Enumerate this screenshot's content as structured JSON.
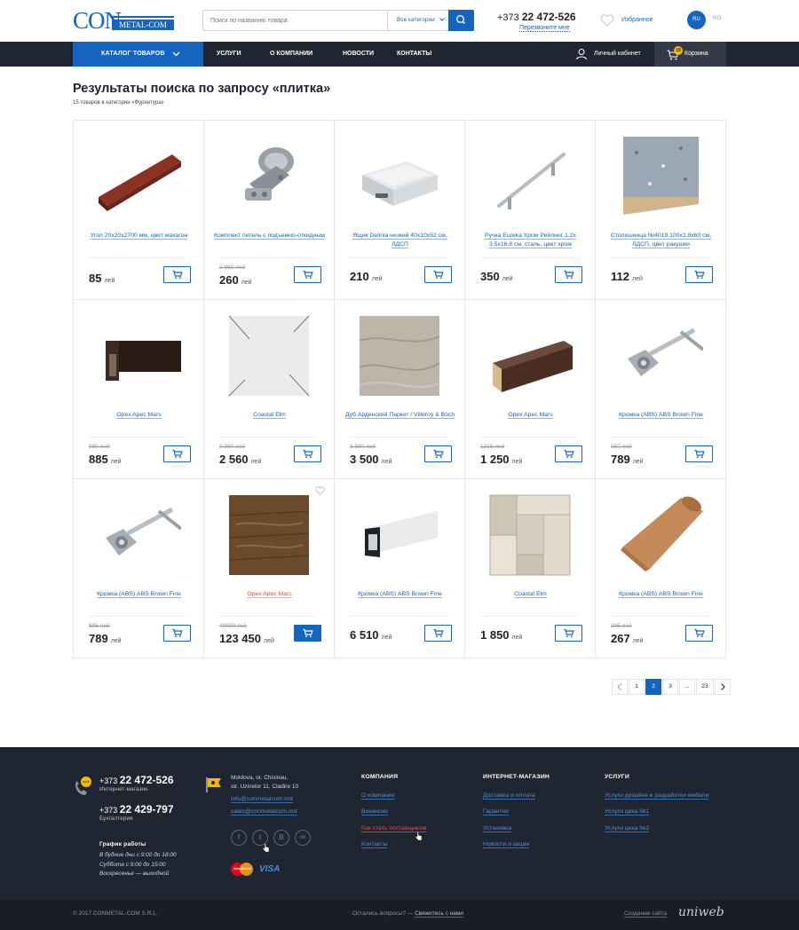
{
  "logo": {
    "text_top": "CON",
    "text_bottom": "METAL-COM"
  },
  "search": {
    "placeholder": "Поиск по названию товара",
    "category": "Все категории"
  },
  "contact": {
    "prefix": "+373",
    "phone": "22 472-526",
    "callback": "Перезвоните мне"
  },
  "favorites": "Избранное",
  "languages": [
    "RU",
    "RO"
  ],
  "nav": {
    "catalog": "КАТАЛОГ ТОВАРОВ",
    "items": [
      "УСЛУГИ",
      "О КОМПАНИИ",
      "НОВОСТИ",
      "КОНТАКТЫ"
    ],
    "cabinet": "Личный кабинет",
    "cart": "Корзина",
    "cart_count": "15"
  },
  "title": "Результаты поиска по запросу «плитка»",
  "subtitle": "15 товаров в категории «Фурнитура»",
  "currency": "лей",
  "products": [
    {
      "name": "Угол 20x20x2700 мм, цвет махагон",
      "old": "",
      "price": "85",
      "image": "angle-profile-image"
    },
    {
      "name": "Комплект петель с подъемно-откидным",
      "old": "2 980 лей",
      "price": "260",
      "image": "hinge-image"
    },
    {
      "name": "Ящик Delinia низкий 40x10x52 см, ЛДСП",
      "old": "",
      "price": "210",
      "image": "drawer-image"
    },
    {
      "name": "Ручка Eureka Хром Рейлинг 1.2x 3.5x16.8 см, сталь, цвет хром",
      "old": "",
      "price": "350",
      "image": "handle-image"
    },
    {
      "name": "Столешница №4019 100x2.8x60 см, ЛДСП, цвет ракушки",
      "old": "",
      "price": "112",
      "image": "countertop-image"
    },
    {
      "name": "Opex Apec Mars",
      "old": "980 лей",
      "price": "885",
      "image": "plinth-profile-image"
    },
    {
      "name": "Coastal Elm",
      "old": "2 980 лей",
      "price": "2 560",
      "image": "white-tile-image"
    },
    {
      "name": "Дуб Арденский Паркет / Villeroy & Boch",
      "old": "3 580 лей",
      "price": "3 500",
      "image": "oak-tile-image"
    },
    {
      "name": "Opex Apec Mars",
      "old": "1315 лей",
      "price": "1 250",
      "image": "wood-plank-image"
    },
    {
      "name": "Кромка (ABS) ABS Brown Fine",
      "old": "987 лей",
      "price": "789",
      "image": "bracket-image"
    },
    {
      "name": "Кромка (ABS) ABS Brown Fine",
      "old": "895 лей",
      "price": "789",
      "image": "bracket-image"
    },
    {
      "name": "Opex Apec Mars",
      "old": "49990 лей",
      "price": "123 450",
      "image": "laminate-image",
      "highlight": true
    },
    {
      "name": "Кромка (ABS) ABS Brown Fine",
      "old": "",
      "price": "6 510",
      "image": "plinth-white-image"
    },
    {
      "name": "Coastal Elm",
      "old": "",
      "price": "1 850",
      "image": "parquet-tile-image"
    },
    {
      "name": "Кромка (ABS) ABS Brown Fine",
      "old": "295 лей",
      "price": "267",
      "image": "cork-roll-image"
    }
  ],
  "pagination": {
    "pages": [
      "1",
      "2",
      "3",
      "...",
      "23"
    ],
    "current": "2"
  },
  "footer": {
    "phone1": {
      "prefix": "+373",
      "number": "22 472-526",
      "label": "Интернет-магазин"
    },
    "phone2": {
      "prefix": "+373",
      "number": "22 429-797",
      "label": "Бухгалтерия"
    },
    "schedule_title": "График работы",
    "schedule": [
      "В будние дни с 9:00 до 18:00",
      "Суббота с 9:00 до 15:00",
      "Воскресенье — выходной"
    ],
    "address": [
      "Moldova, or. Chisinau,",
      "str. Uzinelor 11, Cladire 10"
    ],
    "emails": [
      "info@conmetalcom.md",
      "sales@conmetalcom.md"
    ],
    "social": [
      "f",
      "t",
      "B",
      "ok"
    ],
    "payments": [
      "MasterCard",
      "VISA"
    ],
    "col1": {
      "title": "КОМПАНИЯ",
      "links": [
        "О компании",
        "Вакансии",
        "Как стать поставщиком",
        "Контакты"
      ]
    },
    "col2": {
      "title": "ИНТЕРНЕТ-МАГАЗИН",
      "links": [
        "Доставка и оплата",
        "Гарантия",
        "Установка",
        "Новости и акции"
      ]
    },
    "col3": {
      "title": "УСЛУГИ",
      "links": [
        "Услуги дизайна и разработки мебели",
        "Услуги цеха №1",
        "Услуги цеха №2"
      ]
    },
    "copyright": "© 2017 CONMETAL-COM S.R.L.",
    "question": "Остались вопросы?",
    "contact_us": "Свяжитесь с нами",
    "made_by": "Создание сайта",
    "brand": "uniweb"
  },
  "colors": {
    "accent": "#1565c0",
    "dark": "#1f2631",
    "sale": "#e74c3c"
  }
}
